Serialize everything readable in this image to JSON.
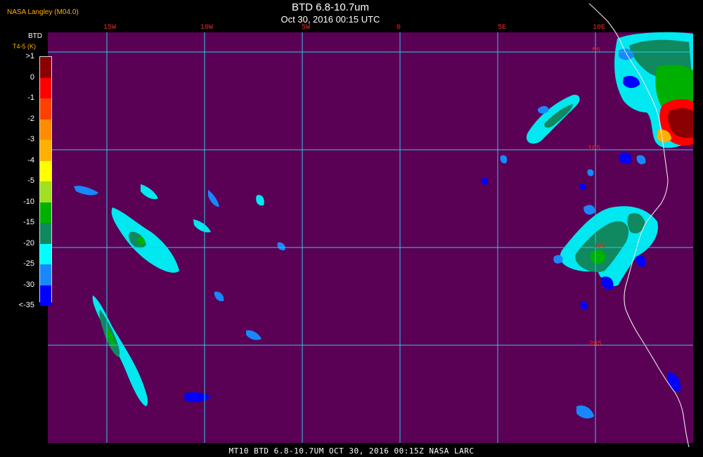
{
  "header": {
    "credit": "NASA Langley (M04.0)",
    "title": "BTD 6.8-10.7um",
    "subtitle": "Oct 30, 2016 00:15 UTC"
  },
  "footer": {
    "text": "MT10  BTD 6.8-10.7UM   OCT 30, 2016 00:15Z   NASA LARC"
  },
  "legend": {
    "title": "BTD",
    "unit": "T4-5 (K)",
    "labels": [
      ">1",
      "0",
      "-1",
      "-2",
      "-3",
      "-4",
      "-5",
      "-10",
      "-15",
      "-20",
      "-25",
      "-30",
      "<-35"
    ],
    "colors": [
      "#8b0000",
      "#ff0000",
      "#ff4000",
      "#ff8c00",
      "#ffb000",
      "#ffff00",
      "#a0e020",
      "#00b000",
      "#108860",
      "#00ffff",
      "#1888ff",
      "#0000ff",
      "#5a0055"
    ]
  },
  "map": {
    "background_color": "#5a0055",
    "grid_color": "#30c8e8",
    "label_color": "#e0302a",
    "coast_color": "#e8e8e8",
    "lon_labels": [
      "15W",
      "10W",
      "5W",
      "0",
      "5E",
      "10E"
    ],
    "lat_labels": [
      "5S",
      "10S",
      "15S",
      "20S"
    ]
  }
}
